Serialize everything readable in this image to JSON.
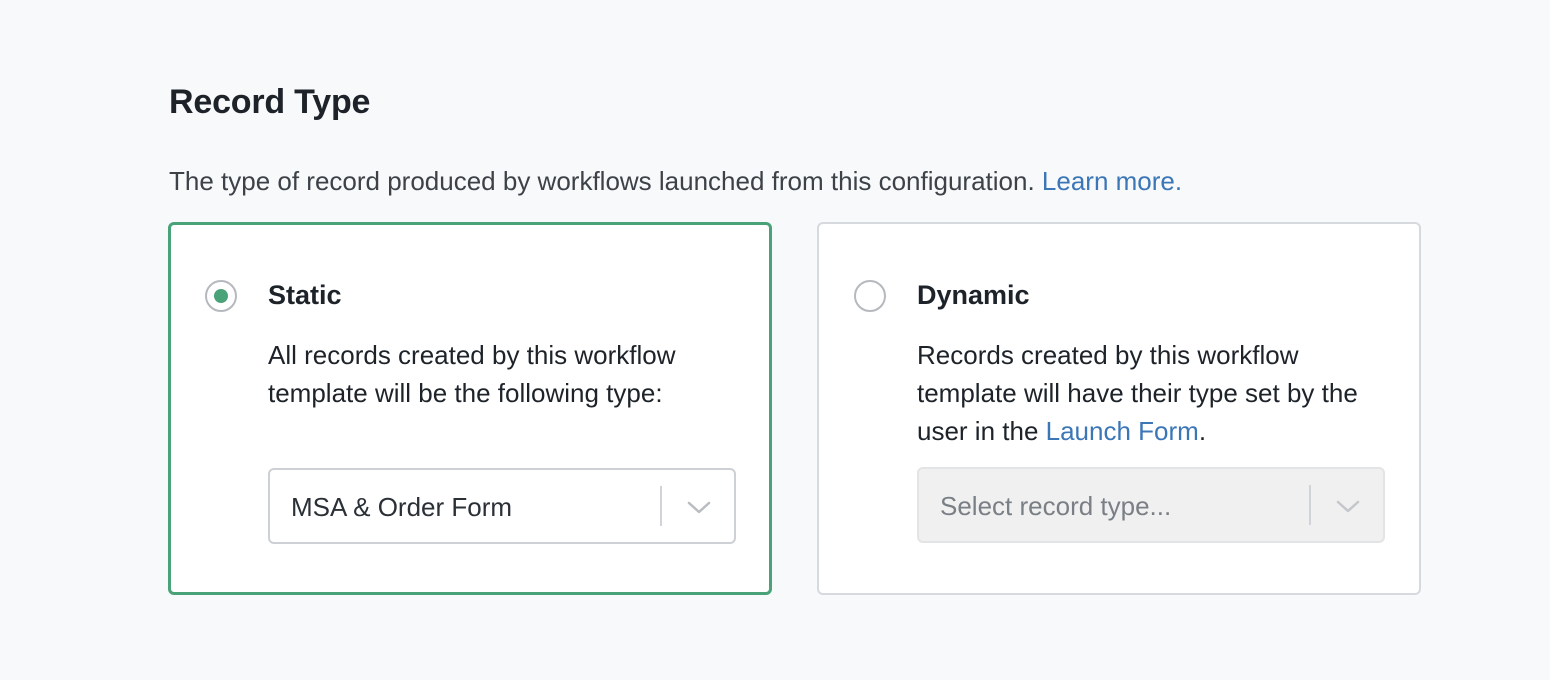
{
  "section": {
    "title": "Record Type",
    "description": "The type of record produced by workflows launched from this configuration.",
    "learn_more": "Learn more."
  },
  "options": {
    "static": {
      "label": "Static",
      "selected": true,
      "body": "All records created by this workflow template will be the following type:",
      "select_value": "MSA & Order Form"
    },
    "dynamic": {
      "label": "Dynamic",
      "selected": false,
      "body_before": "Records created by this workflow template will have their type set by the user in the ",
      "body_link": "Launch Form",
      "body_after": ".",
      "select_placeholder": "Select record type..."
    }
  },
  "colors": {
    "accent": "#4aa278",
    "link": "#3b76b7",
    "border": "#d6d9dd",
    "background": "#f8f9fb"
  },
  "icons": {
    "dropdown": "chevron-down-icon"
  }
}
